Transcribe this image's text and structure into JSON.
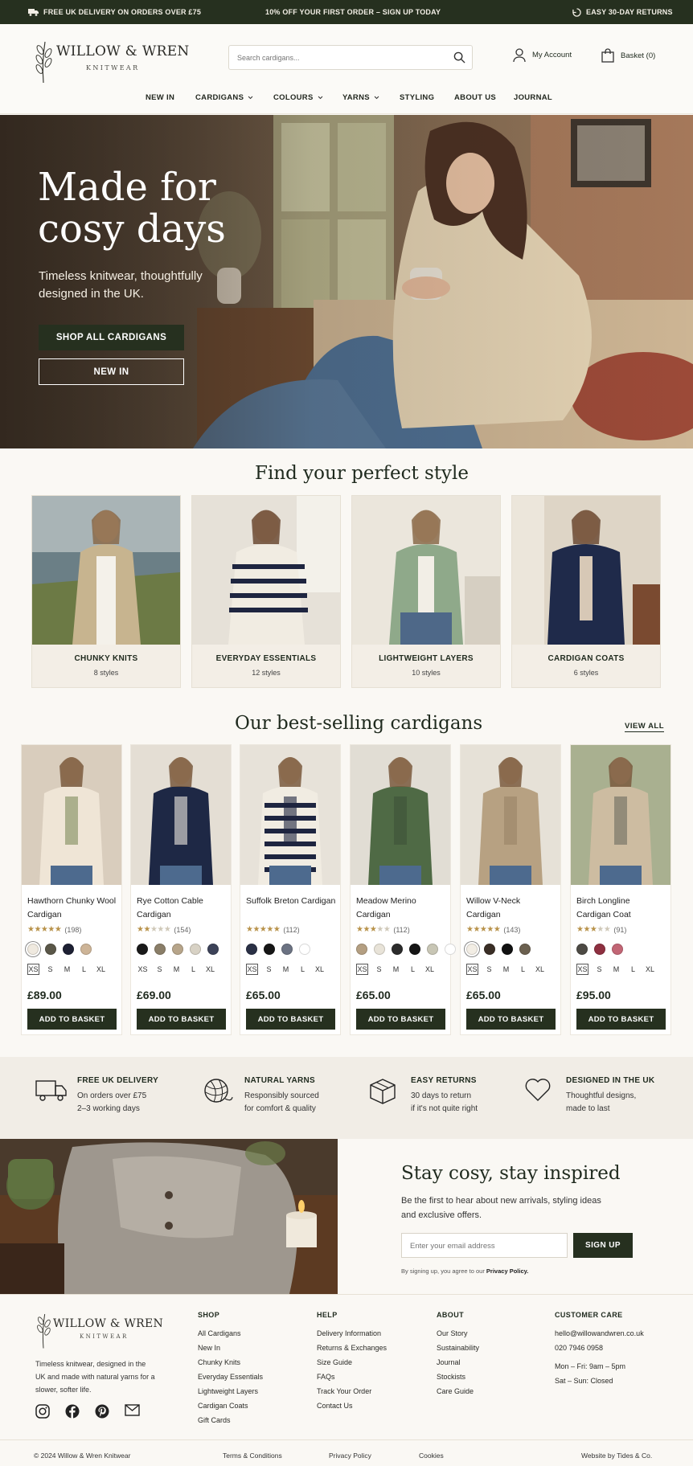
{
  "topbar": {
    "delivery": "FREE UK DELIVERY ON ORDERS OVER £75",
    "promo": "10% OFF YOUR FIRST ORDER – SIGN UP TODAY",
    "returns": "EASY 30-DAY RETURNS"
  },
  "brand": {
    "name": "WILLOW & WREN",
    "tagline": "KNITWEAR"
  },
  "search": {
    "placeholder": "Search cardigans..."
  },
  "account": {
    "label": "My Account"
  },
  "basket": {
    "label": "Basket (0)"
  },
  "nav": {
    "new_in": "NEW IN",
    "cardigans": "CARDIGANS",
    "colours": "COLOURS",
    "yarns": "YARNS",
    "styling": "STYLING",
    "about": "ABOUT US",
    "journal": "JOURNAL"
  },
  "hero": {
    "title": "Made for cosy days",
    "subtitle": "Timeless knitwear, thoughtfully designed in the UK.",
    "primary_cta": "SHOP ALL CARDIGANS",
    "secondary_cta": "NEW IN"
  },
  "styles": {
    "title": "Find your perfect style",
    "items": [
      {
        "title": "CHUNKY KNITS",
        "count": "8 styles"
      },
      {
        "title": "EVERYDAY ESSENTIALS",
        "count": "12 styles"
      },
      {
        "title": "LIGHTWEIGHT LAYERS",
        "count": "10 styles"
      },
      {
        "title": "CARDIGAN COATS",
        "count": "6 styles"
      }
    ]
  },
  "bestsellers": {
    "title": "Our best-selling cardigans",
    "view_all": "VIEW ALL",
    "sizes": [
      "XS",
      "S",
      "M",
      "L",
      "XL"
    ],
    "add_label": "ADD TO BASKET",
    "products": [
      {
        "name": "Hawthorn Chunky Wool Cardigan",
        "rating": 4.5,
        "reviews": "(198)",
        "price": "£89.00",
        "swatches": [
          "#efe9df",
          "#5a5748",
          "#1d2033",
          "#cdb497"
        ]
      },
      {
        "name": "Rye Cotton Cable Cardigan",
        "rating": 2,
        "reviews": "(154)",
        "price": "£69.00",
        "swatches": [
          "#1a1a1a",
          "#8a7e68",
          "#b7a58a",
          "#d8d2c5",
          "#3c4258"
        ]
      },
      {
        "name": "Suffolk Breton Cardigan",
        "rating": 5,
        "reviews": "(112)",
        "price": "£65.00",
        "swatches": [
          "#2a3045",
          "#161616",
          "#6b7282",
          "#ffffff"
        ]
      },
      {
        "name": "Meadow Merino Cardigan",
        "rating": 3,
        "reviews": "(112)",
        "price": "£65.00",
        "swatches": [
          "#b49f82",
          "#e8e3d8",
          "#2b2b2b",
          "#151515",
          "#c8c6b5",
          "#ffffff"
        ]
      },
      {
        "name": "Willow V-Neck Cardigan",
        "rating": 4.5,
        "reviews": "(143)",
        "price": "£65.00",
        "swatches": [
          "#f2ede4",
          "#3a2e26",
          "#111111",
          "#6b604f"
        ]
      },
      {
        "name": "Birch Longline Cardigan Coat",
        "rating": 2.5,
        "reviews": "(91)",
        "price": "£95.00",
        "swatches": [
          "#4d4a44",
          "#8e3040",
          "#c26675"
        ]
      }
    ]
  },
  "features": [
    {
      "icon": "delivery-van-icon",
      "title": "FREE UK DELIVERY",
      "line1": "On orders over £75",
      "line2": "2–3 working days"
    },
    {
      "icon": "yarn-ball-icon",
      "title": "NATURAL YARNS",
      "line1": "Responsibly sourced",
      "line2": "for comfort & quality"
    },
    {
      "icon": "box-icon",
      "title": "EASY RETURNS",
      "line1": "30 days to return",
      "line2": "if it's not quite right"
    },
    {
      "icon": "heart-icon",
      "title": "DESIGNED IN THE UK",
      "line1": "Thoughtful designs,",
      "line2": "made to last"
    }
  ],
  "newsletter": {
    "title": "Stay cosy, stay inspired",
    "subtitle": "Be the first to hear about new arrivals, styling ideas and exclusive offers.",
    "placeholder": "Enter your email address",
    "button": "SIGN UP",
    "note": "By signing up, you agree to our",
    "policy": "Privacy Policy."
  },
  "footer": {
    "tagline": "Timeless knitwear, designed in the UK and made with natural yarns for a slower, softer life.",
    "shop": {
      "title": "SHOP",
      "links": [
        "All Cardigans",
        "New In",
        "Chunky Knits",
        "Everyday Essentials",
        "Lightweight Layers",
        "Cardigan Coats",
        "Gift Cards"
      ]
    },
    "help": {
      "title": "HELP",
      "links": [
        "Delivery Information",
        "Returns & Exchanges",
        "Size Guide",
        "FAQs",
        "Track Your Order",
        "Contact Us"
      ]
    },
    "about": {
      "title": "ABOUT",
      "links": [
        "Our Story",
        "Sustainability",
        "Journal",
        "Stockists",
        "Care Guide"
      ]
    },
    "care": {
      "title": "CUSTOMER CARE",
      "email": "hello@willowandwren.co.uk",
      "phone": "020 7946 0958",
      "hours1": "Mon – Fri: 9am – 5pm",
      "hours2": "Sat – Sun: Closed"
    },
    "copyright": "© 2024 Willow & Wren Knitwear",
    "terms": "Terms & Conditions",
    "privacy": "Privacy Policy",
    "cookies": "Cookies",
    "credit": "Website by Tides & Co."
  },
  "colors": {
    "accent": "#26301f",
    "background": "#faf8f4",
    "star": "#b8924a"
  }
}
